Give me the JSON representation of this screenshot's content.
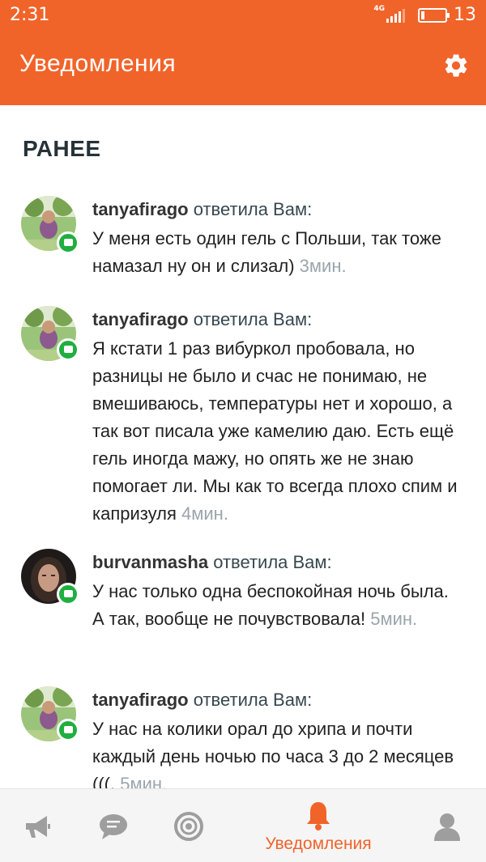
{
  "status_bar": {
    "time": "2:31",
    "network": "4G",
    "battery_level": "13",
    "battery_fraction": 0.13
  },
  "header": {
    "title": "Уведомления",
    "settings_icon": "gear-icon"
  },
  "section": {
    "title": "РАНЕЕ"
  },
  "notifications": [
    {
      "user": "tanyafirago",
      "action": "ответила Вам:",
      "message": "У меня есть один гель с Польши, так тоже намазал ну он и слизал)",
      "time": "3мин."
    },
    {
      "user": "tanyafirago",
      "action": "ответила Вам:",
      "message": "Я кстати 1 раз вибуркол пробовала, но разницы не было и счас не понимаю, не вмешиваюсь, температуры нет и хорошо, а так вот писала уже камелию даю. Есть ещё гель иногда мажу, но опять же не знаю помогает ли. Мы как то всегда плохо спим и капризуля",
      "time": "4мин."
    },
    {
      "user": "burvanmasha",
      "action": "ответила Вам:",
      "message": "У нас только одна беспокойная ночь была. А так, вообще не почувствовала!",
      "time": "5мин."
    },
    {
      "user": "tanyafirago",
      "action": "ответила Вам:",
      "message": "У нас на колики орал до хрипа и почти каждый день ночью по часа 3 до 2 месяцев (((.",
      "time": "5мин."
    }
  ],
  "bottom_nav": {
    "items": [
      {
        "icon": "megaphone-icon",
        "label": ""
      },
      {
        "icon": "chat-icon",
        "label": ""
      },
      {
        "icon": "target-icon",
        "label": ""
      },
      {
        "icon": "bell-icon",
        "label": "Уведомления",
        "active": true
      },
      {
        "icon": "profile-icon",
        "label": ""
      }
    ]
  },
  "colors": {
    "accent": "#f0642a",
    "badge": "#1fae3f",
    "time_text": "#9aa5ab",
    "title_text": "#263238"
  }
}
